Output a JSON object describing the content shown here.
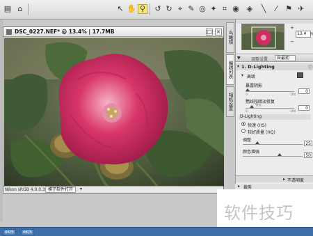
{
  "toolbar": {
    "icons": [
      "selection-arrow-icon",
      "hand-icon",
      "zoom-icon",
      "rotate-left-icon",
      "rotate-right-icon",
      "straighten-icon",
      "color-picker-icon",
      "red-eye-icon",
      "retouch-icon",
      "crop-icon",
      "control-point-icon",
      "line-icon",
      "flag-icon",
      "share-icon"
    ]
  },
  "document": {
    "title": "DSC_0227.NEF* @ 13.4% | 17.7MB",
    "status_left": "Nikon sRGB 4.0.0.3002",
    "status_mode": "模子软件打开"
  },
  "vertical_tabs": [
    "鸟瞰镜",
    "编辑列表",
    "相机设置"
  ],
  "navigator": {
    "zoom": "13.4",
    "unit": "%"
  },
  "adjust_panel": {
    "header_label": "调整设置",
    "header_select": "自最初",
    "section_title": "1. D-Lighting",
    "enhance_label": "高级",
    "shadow_label": "暴露阴影",
    "shadow_value": "0",
    "shadow_min": "0",
    "shadow_max": "100",
    "highlight_label": "黯线和暗淡修复",
    "highlight_value": "0",
    "highlight_min": "0",
    "highlight_max": "100",
    "highlight_tag": "锐化",
    "sub_title": "D-Lighting",
    "radio_fast": "快速 (HS)",
    "radio_quality": "较好质量 (HQ)",
    "adjust_label": "调整",
    "adjust_value": "25",
    "color_label": "颜色增强",
    "color_value": "50",
    "footer_label": "不透明度",
    "crop_label": "裁剪"
  },
  "taskbar": {
    "items": [
      "ok/5",
      "ok/5"
    ]
  },
  "watermark": {
    "text": "软件技巧"
  }
}
